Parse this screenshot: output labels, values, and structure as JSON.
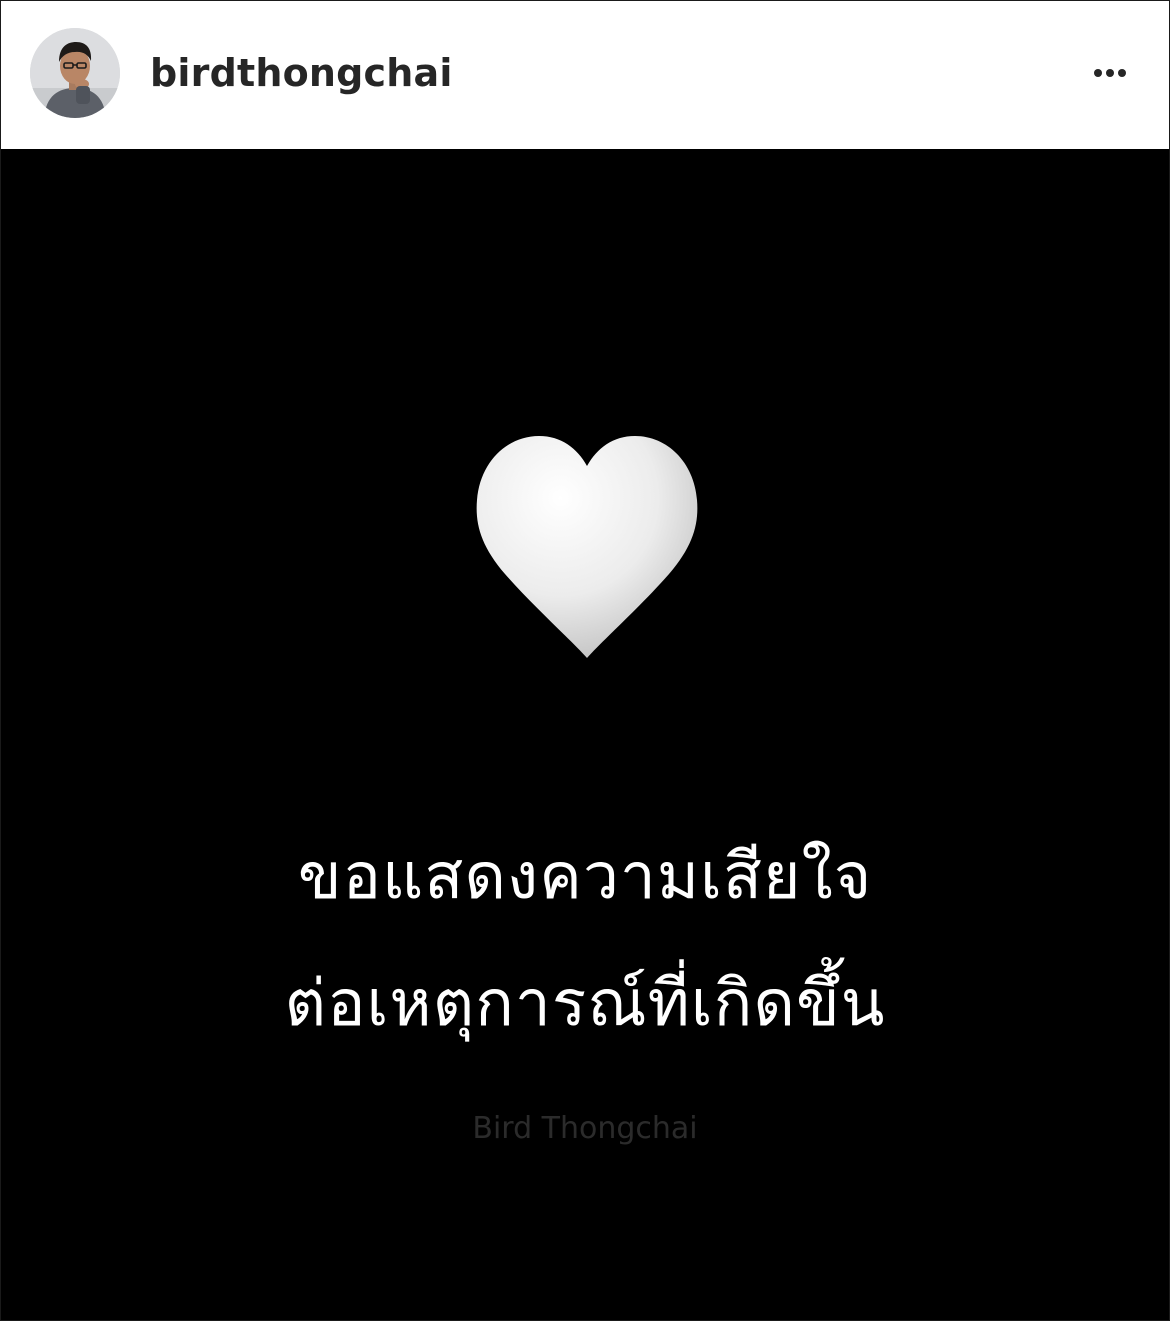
{
  "header": {
    "username": "birdthongchai",
    "avatar_icon": "profile-photo",
    "more_icon": "more-options-icon"
  },
  "post": {
    "background_color": "#000000",
    "heart_icon": "white-heart-emoji",
    "message_line_1": "ขอแสดงความเสียใจ",
    "message_line_2": "ต่อเหตุการณ์ที่เกิดขึ้น",
    "watermark": "Bird Thongchai"
  }
}
